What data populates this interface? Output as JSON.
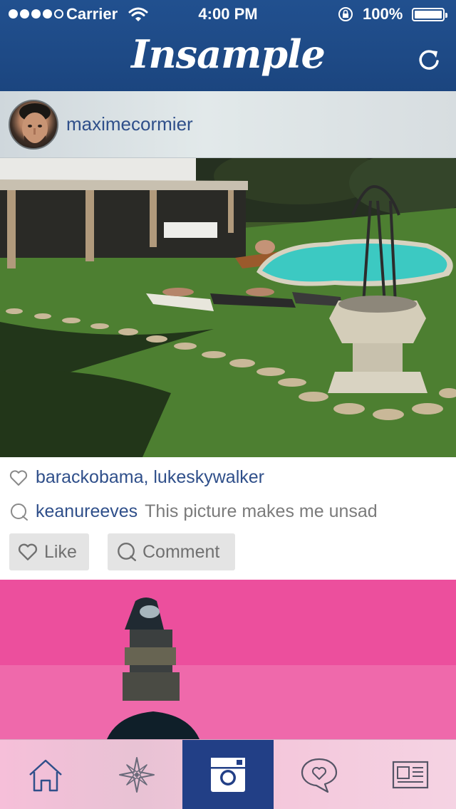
{
  "status_bar": {
    "carrier": "Carrier",
    "time": "4:00 PM",
    "battery_percent": "100%",
    "signal_strength": 4,
    "signal_max": 5
  },
  "navbar": {
    "title": "Insample",
    "refresh_icon": "refresh-icon"
  },
  "post": {
    "username": "maximecormier",
    "likes": "barackobama, lukeskywalker",
    "comment": {
      "user": "keanureeves",
      "text": "This picture makes me unsad"
    },
    "like_button_label": "Like",
    "comment_button_label": "Comment"
  },
  "tab_bar": {
    "tabs": [
      {
        "icon": "home-icon",
        "active": false
      },
      {
        "icon": "compass-icon",
        "active": false
      },
      {
        "icon": "camera-icon",
        "active": true
      },
      {
        "icon": "heart-speech-bubble-icon",
        "active": false
      },
      {
        "icon": "newspaper-icon",
        "active": false
      }
    ]
  },
  "colors": {
    "header_blue": "#1e4a86",
    "link_blue": "#2f4f8a",
    "active_tab": "#223f86",
    "button_gray": "#e4e4e4"
  }
}
